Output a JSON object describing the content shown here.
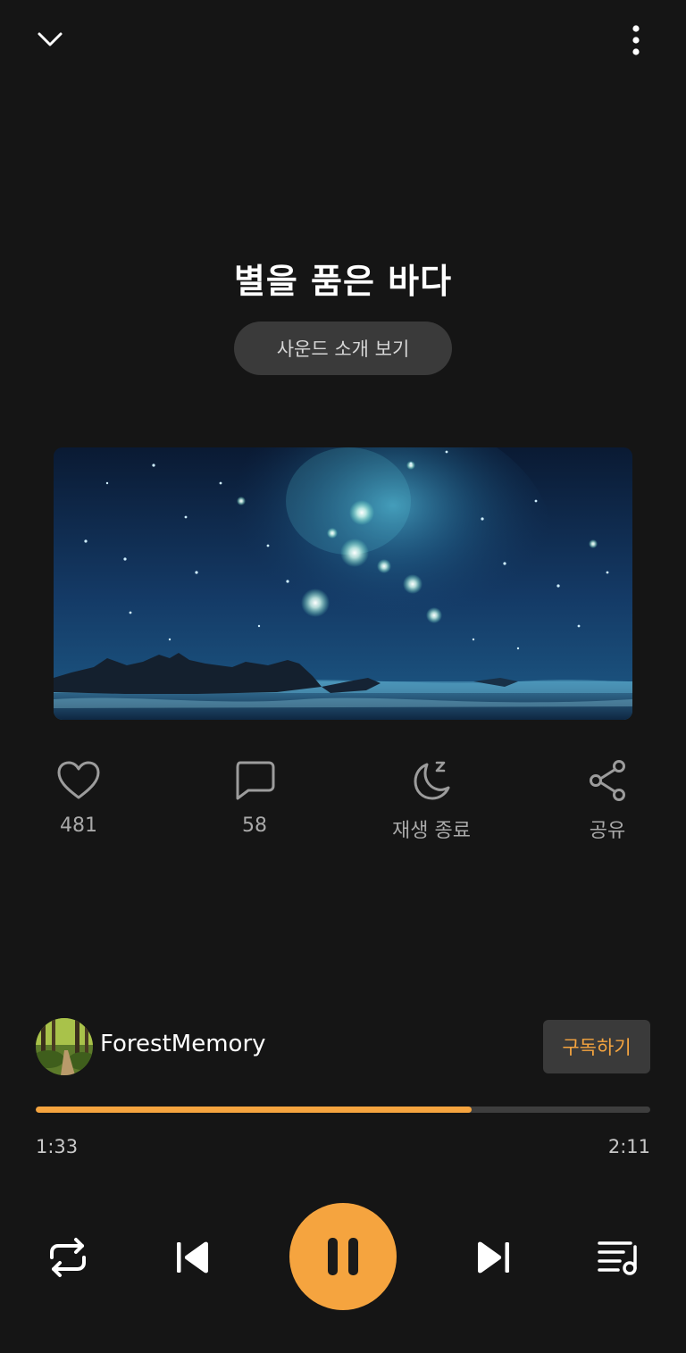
{
  "header": {
    "collapse_icon": "chevron-down-icon",
    "more_icon": "more-vertical-icon"
  },
  "track": {
    "title": "별을 품은 바다",
    "intro_button": "사운드 소개 보기",
    "artwork": "starry-night-sea-image"
  },
  "actions": {
    "like": {
      "icon": "heart-icon",
      "label": "481"
    },
    "comment": {
      "icon": "comment-icon",
      "label": "58"
    },
    "sleep": {
      "icon": "moon-icon",
      "label": "재생 종료"
    },
    "share": {
      "icon": "share-icon",
      "label": "공유"
    }
  },
  "creator": {
    "name": "ForestMemory",
    "avatar": "forest-path-avatar",
    "subscribe_label": "구독하기"
  },
  "playback": {
    "current_time": "1:33",
    "total_time": "2:11",
    "progress": 0.71,
    "accent_color": "#f5a43f"
  },
  "controls": {
    "repeat_icon": "repeat-icon",
    "previous_icon": "skip-previous-icon",
    "play_pause_icon": "pause-icon",
    "next_icon": "skip-next-icon",
    "playlist_icon": "playlist-icon"
  }
}
